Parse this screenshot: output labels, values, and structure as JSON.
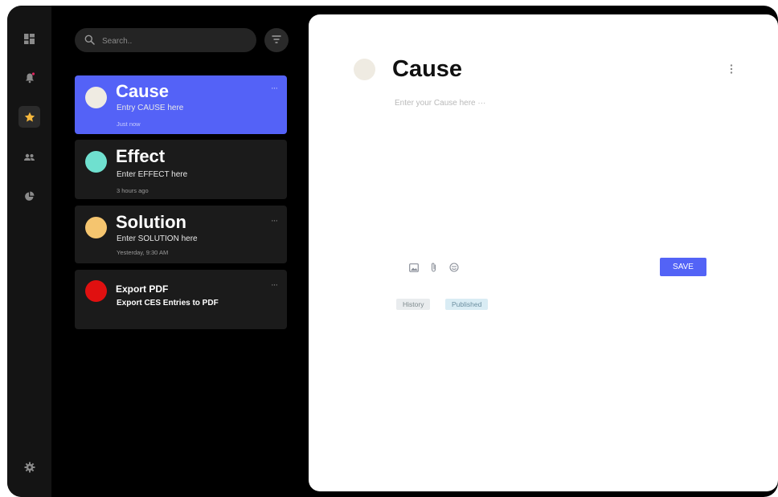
{
  "sidebar": {
    "icons": [
      "dashboard-icon",
      "bell-icon",
      "star-icon",
      "users-icon",
      "pie-chart-icon",
      "gear-icon"
    ],
    "active": "star-icon",
    "notification_color": "#e0245e"
  },
  "search": {
    "placeholder": "Search.."
  },
  "entries": [
    {
      "title": "Cause",
      "subtitle": "Entry CAUSE here",
      "time": "Just now",
      "dot_color": "#efebe2",
      "selected": true
    },
    {
      "title": "Effect",
      "subtitle": "Enter EFFECT here",
      "time": "3 hours ago",
      "dot_color": "#6fe0cf",
      "selected": false
    },
    {
      "title": "Solution",
      "subtitle": "Enter SOLUTION here",
      "time": "Yesterday, 9:30 AM",
      "dot_color": "#f5c56f",
      "selected": false
    },
    {
      "title": "Export PDF",
      "subtitle": "Export CES Entries to PDF",
      "time": "",
      "dot_color": "#e01010",
      "selected": false
    }
  ],
  "more_glyph": "···",
  "editor": {
    "title": "Cause",
    "placeholder": "Enter your Cause here ···",
    "toolbar_icons": [
      "image-icon",
      "attachment-icon",
      "emoji-icon"
    ],
    "save_label": "SAVE",
    "tags": [
      "History",
      "Published"
    ]
  },
  "colors": {
    "accent": "#5462f7",
    "background": "#000000",
    "card": "#1b1b1b",
    "rail": "#141414"
  }
}
